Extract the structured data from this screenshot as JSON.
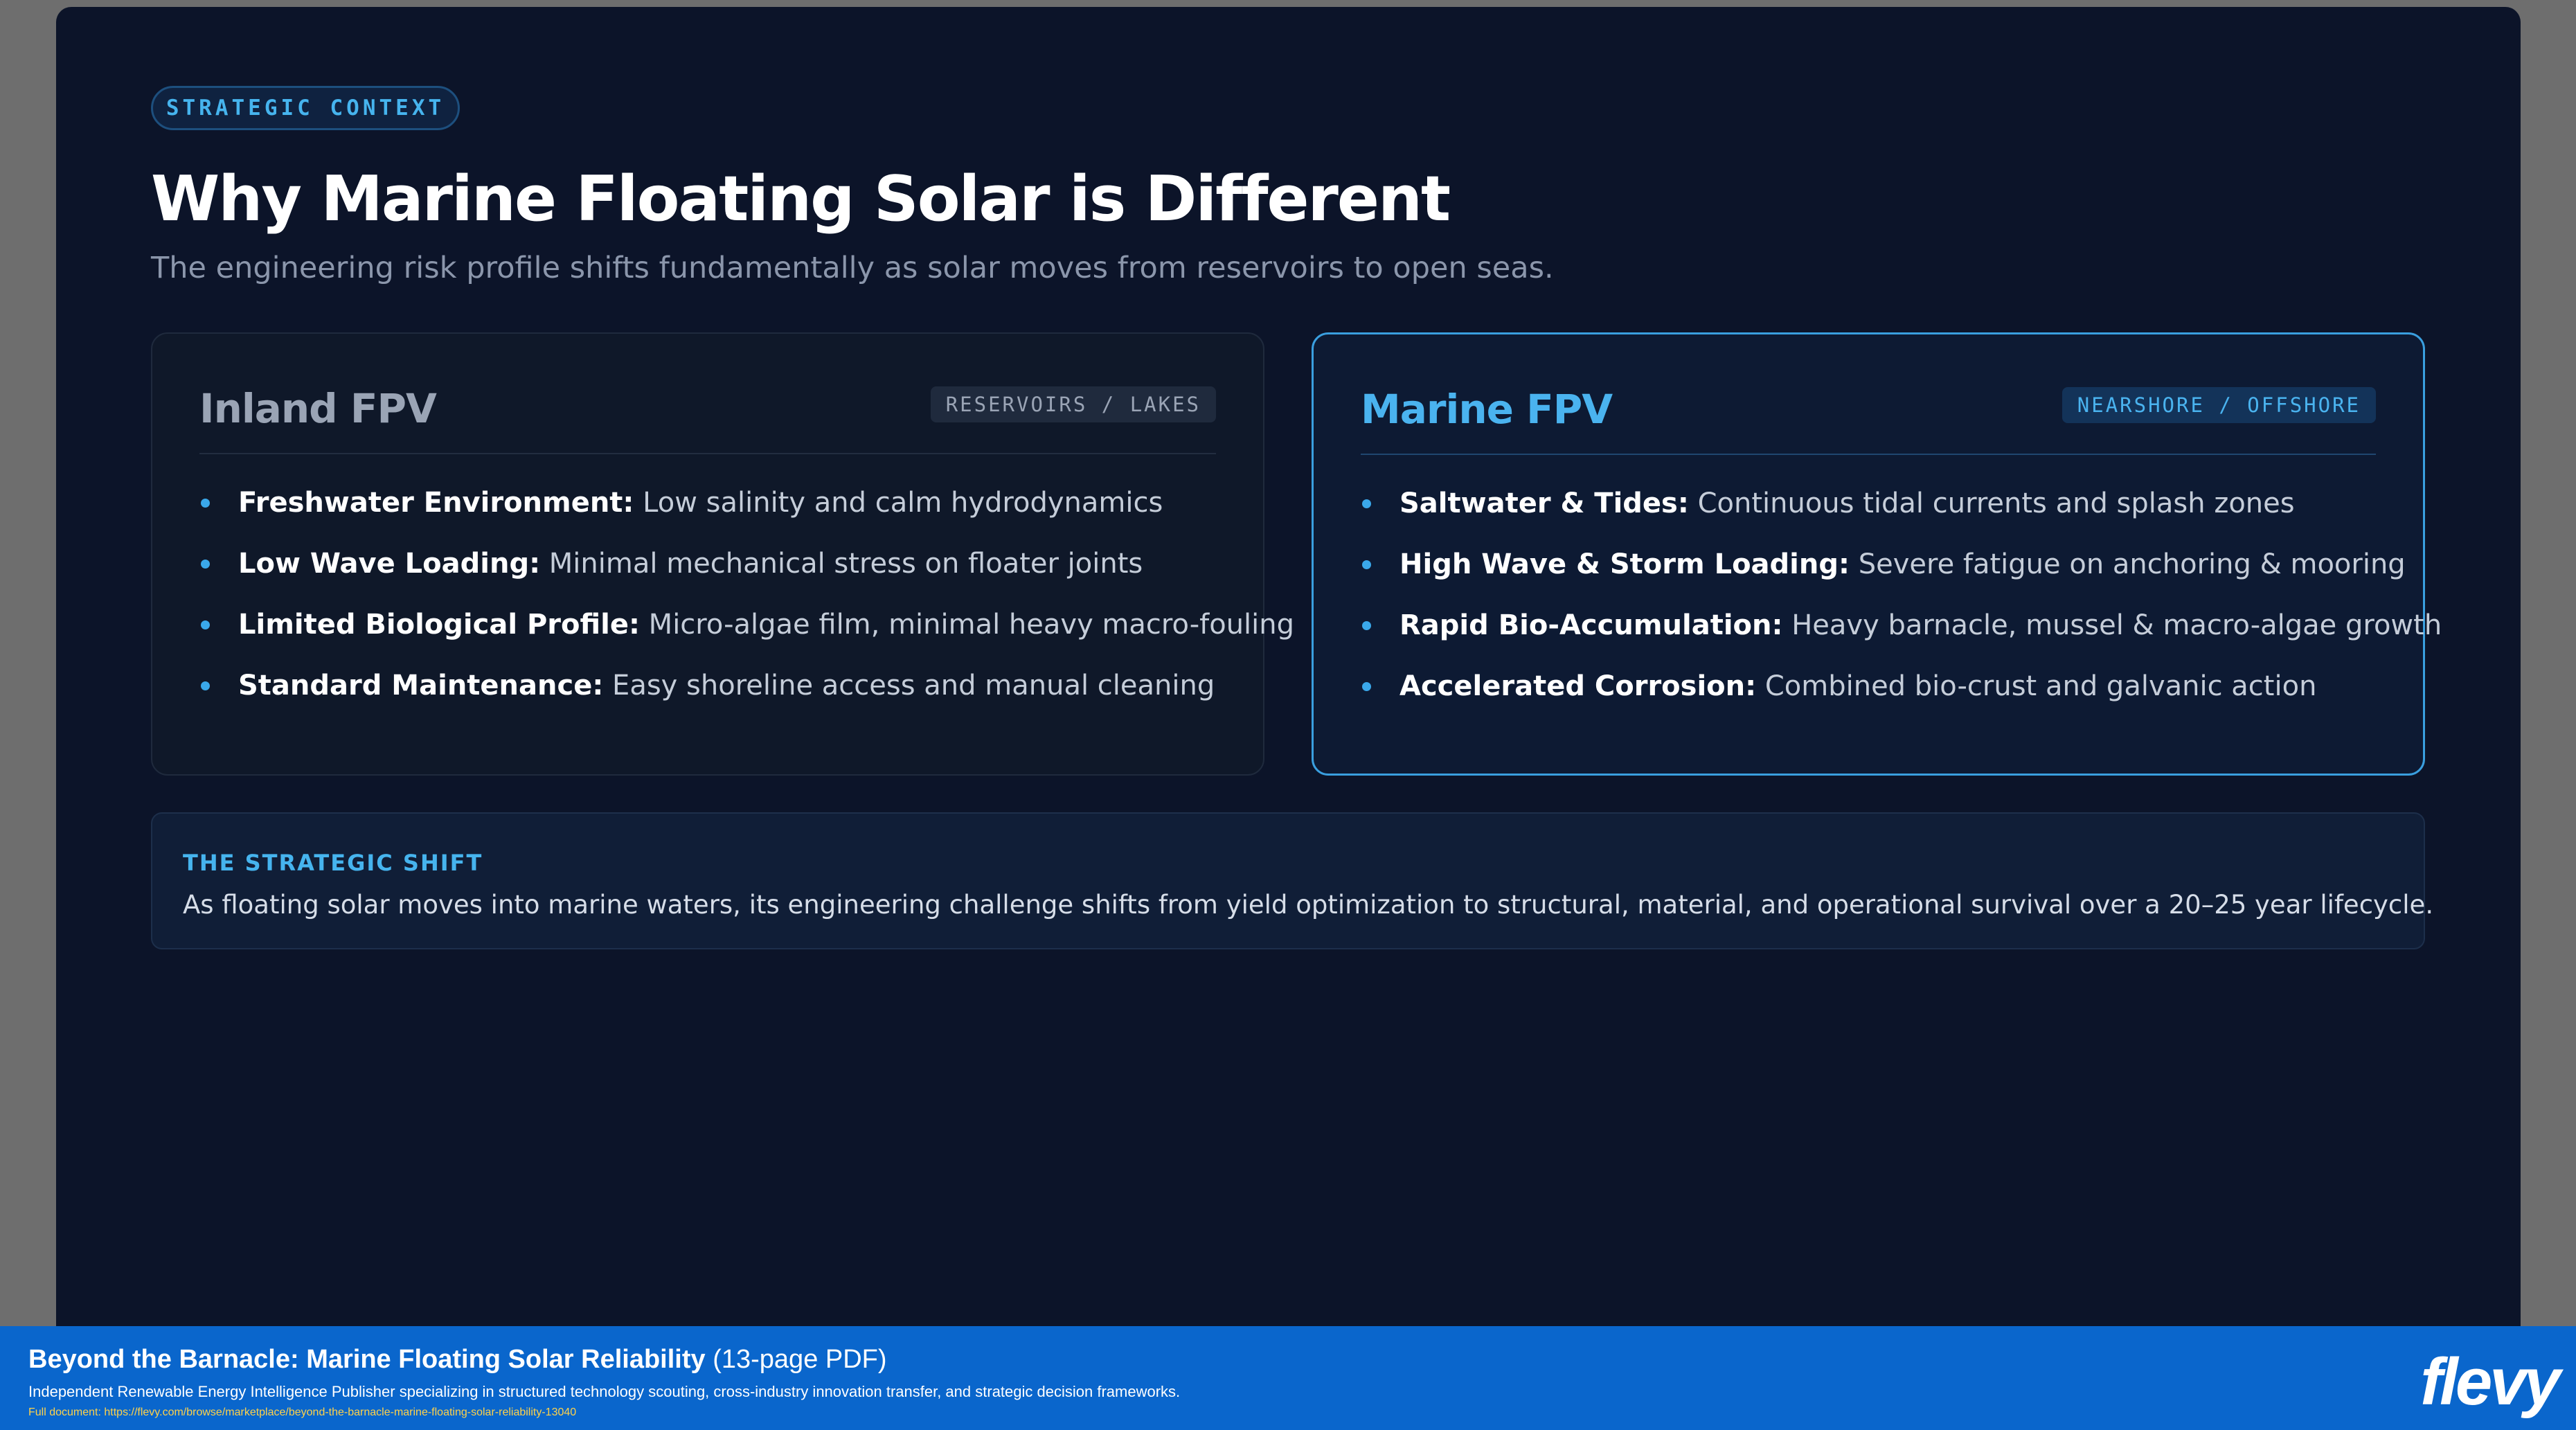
{
  "header": {
    "pill": "STRATEGIC CONTEXT",
    "title": "Why Marine Floating Solar is Different",
    "subtitle": "The engineering risk profile shifts fundamentally as solar moves from reservoirs to open seas."
  },
  "inland": {
    "title": "Inland FPV",
    "tag": "RESERVOIRS / LAKES",
    "bullets": [
      {
        "label": "Freshwater Environment:",
        "text": " Low salinity and calm hydrodynamics"
      },
      {
        "label": "Low Wave Loading:",
        "text": " Minimal mechanical stress on floater joints"
      },
      {
        "label": "Limited Biological Profile:",
        "text": " Micro-algae film, minimal heavy macro-fouling"
      },
      {
        "label": "Standard Maintenance:",
        "text": " Easy shoreline access and manual cleaning"
      }
    ]
  },
  "marine": {
    "title": "Marine FPV",
    "tag": "NEARSHORE / OFFSHORE",
    "bullets": [
      {
        "label": "Saltwater & Tides:",
        "text": " Continuous tidal currents and splash zones"
      },
      {
        "label": "High Wave & Storm Loading:",
        "text": " Severe fatigue on anchoring & mooring"
      },
      {
        "label": "Rapid Bio-Accumulation:",
        "text": " Heavy barnacle, mussel & macro-algae growth"
      },
      {
        "label": "Accelerated Corrosion:",
        "text": " Combined bio-crust and galvanic action"
      }
    ]
  },
  "shift": {
    "label": "THE STRATEGIC SHIFT",
    "text": "As floating solar moves into marine waters, its engineering challenge shifts from yield optimization to structural, material, and operational survival over a 20–25 year lifecycle."
  },
  "footer": {
    "title": "Beyond the Barnacle: Marine Floating Solar Reliability",
    "pages": " (13-page PDF)",
    "description": "Independent Renewable Energy Intelligence Publisher specializing in structured technology scouting, cross-industry innovation transfer, and strategic decision frameworks.",
    "url": "Full document: https://flevy.com/browse/marketplace/beyond-the-barnacle-marine-floating-solar-reliability-13040",
    "brand": "flevy"
  },
  "colors": {
    "background": "#0c1429",
    "accent": "#46b4ee",
    "footer": "#0a66cc"
  }
}
